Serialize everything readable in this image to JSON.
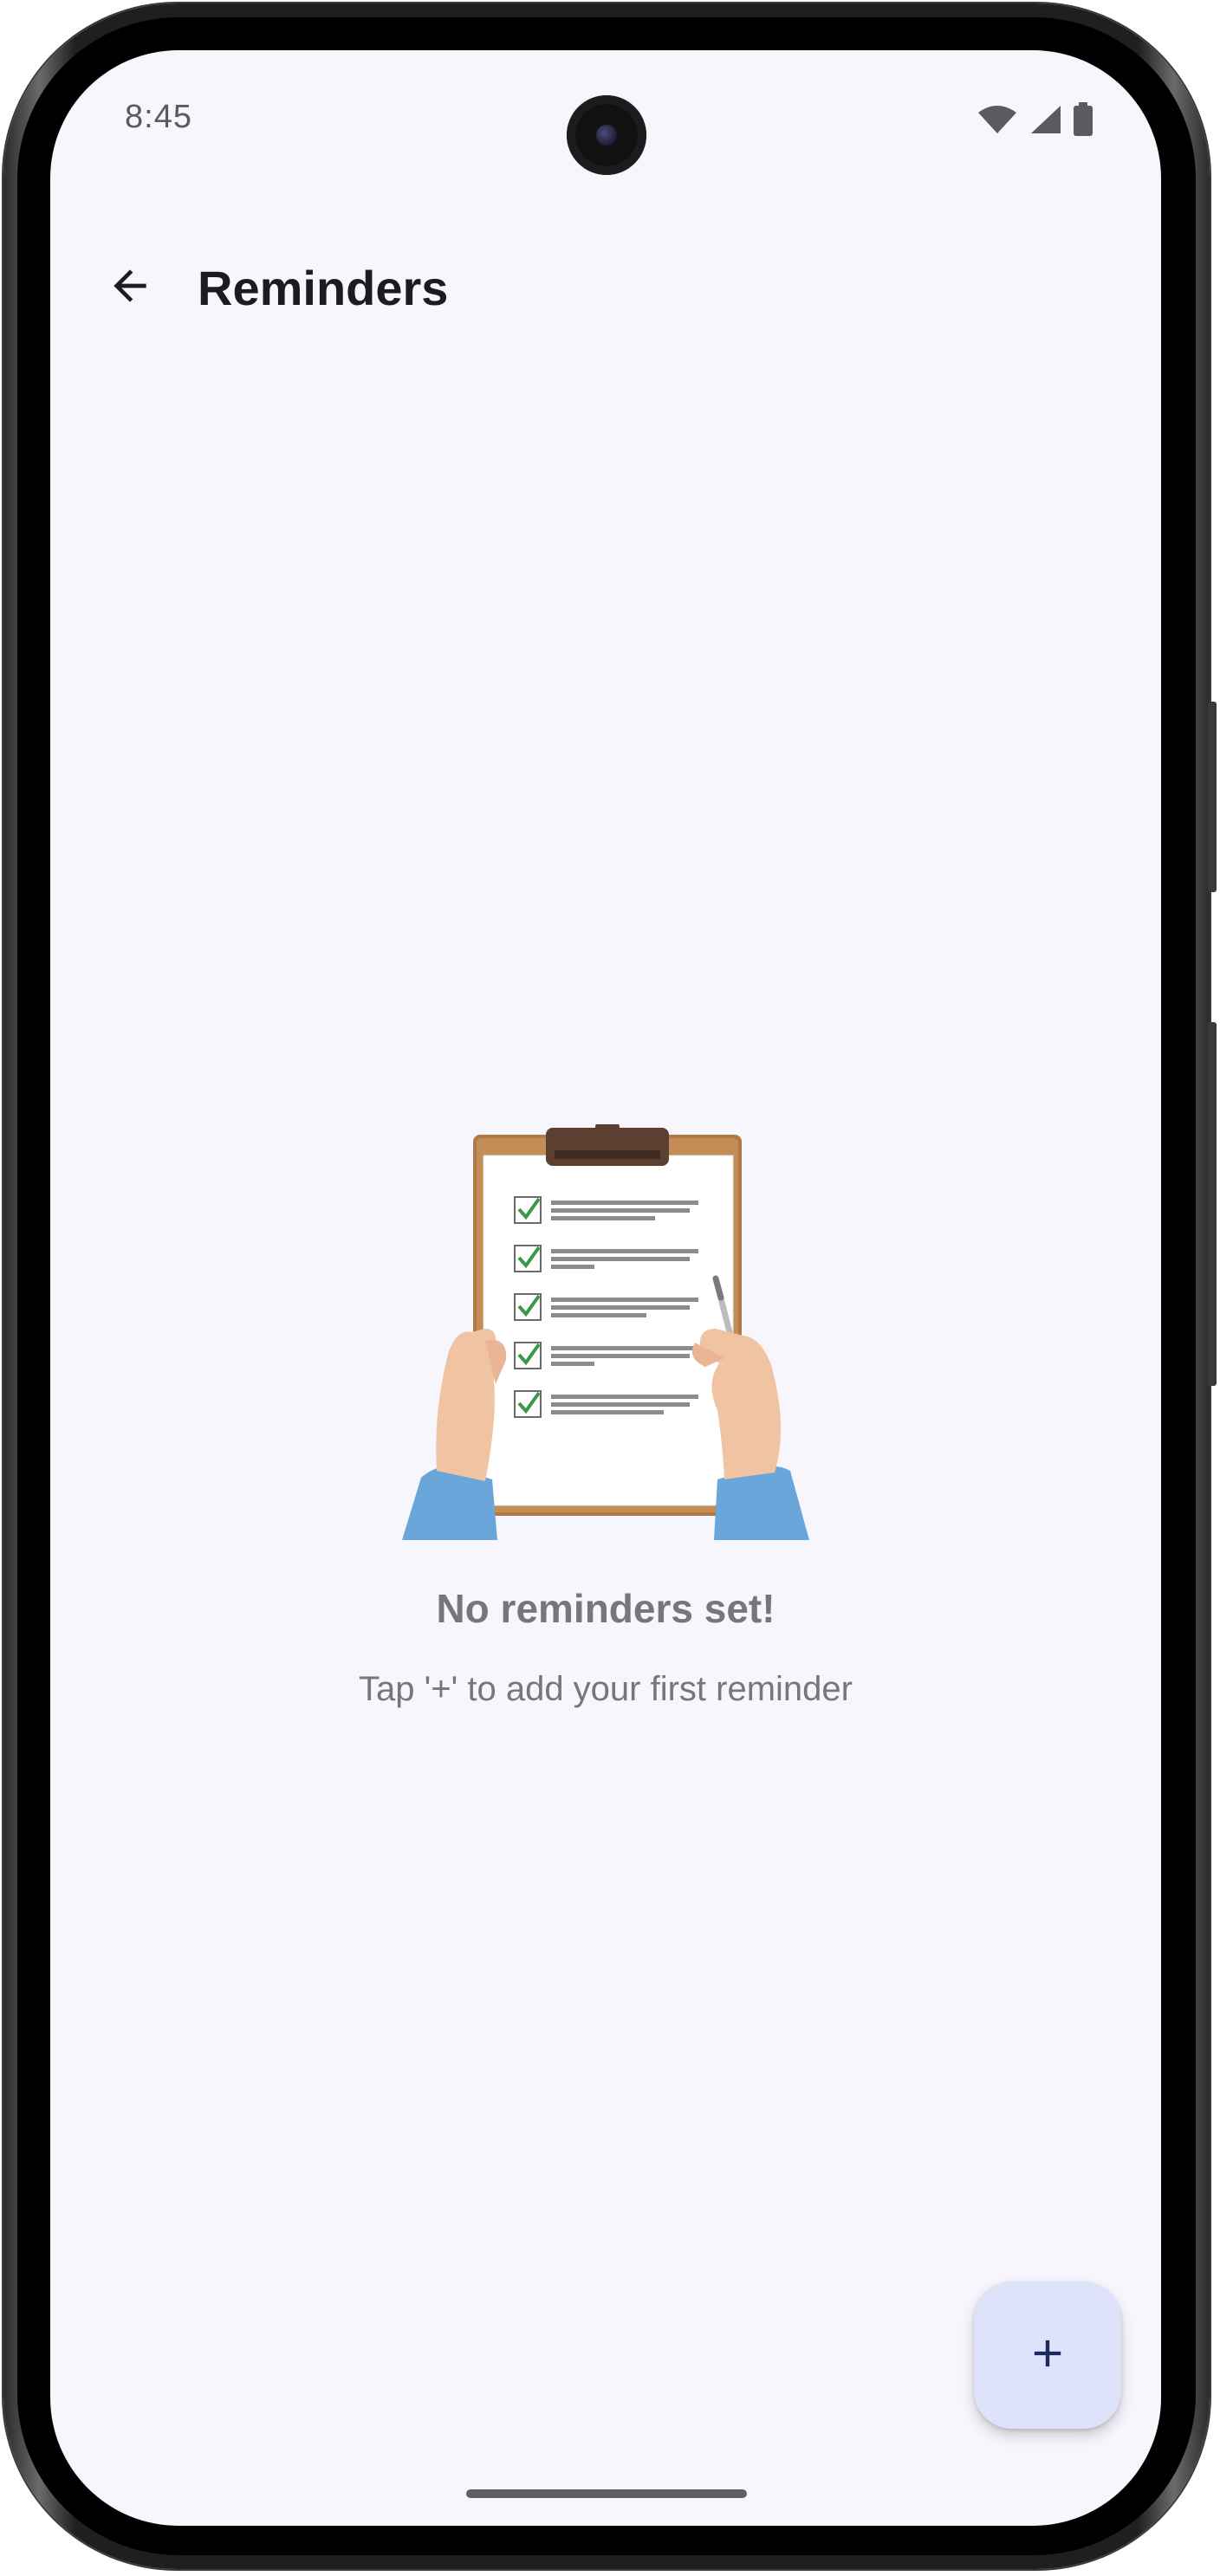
{
  "status_bar": {
    "time": "8:45",
    "icons": [
      "wifi-icon",
      "cell-signal-icon",
      "battery-icon"
    ]
  },
  "app_bar": {
    "back_icon": "arrow-back-icon",
    "title": "Reminders"
  },
  "empty_state": {
    "illustration": "clipboard-checklist-illustration",
    "title": "No reminders set!",
    "subtitle": "Tap '+' to add your first reminder"
  },
  "fab": {
    "icon": "plus-icon"
  },
  "colors": {
    "background": "#f7f6fd",
    "title_text": "#1b1b21",
    "muted_text": "#77767b",
    "fab_background": "#dfe2fb",
    "fab_icon": "#1b2a5a",
    "check_green": "#3b9a4a"
  }
}
